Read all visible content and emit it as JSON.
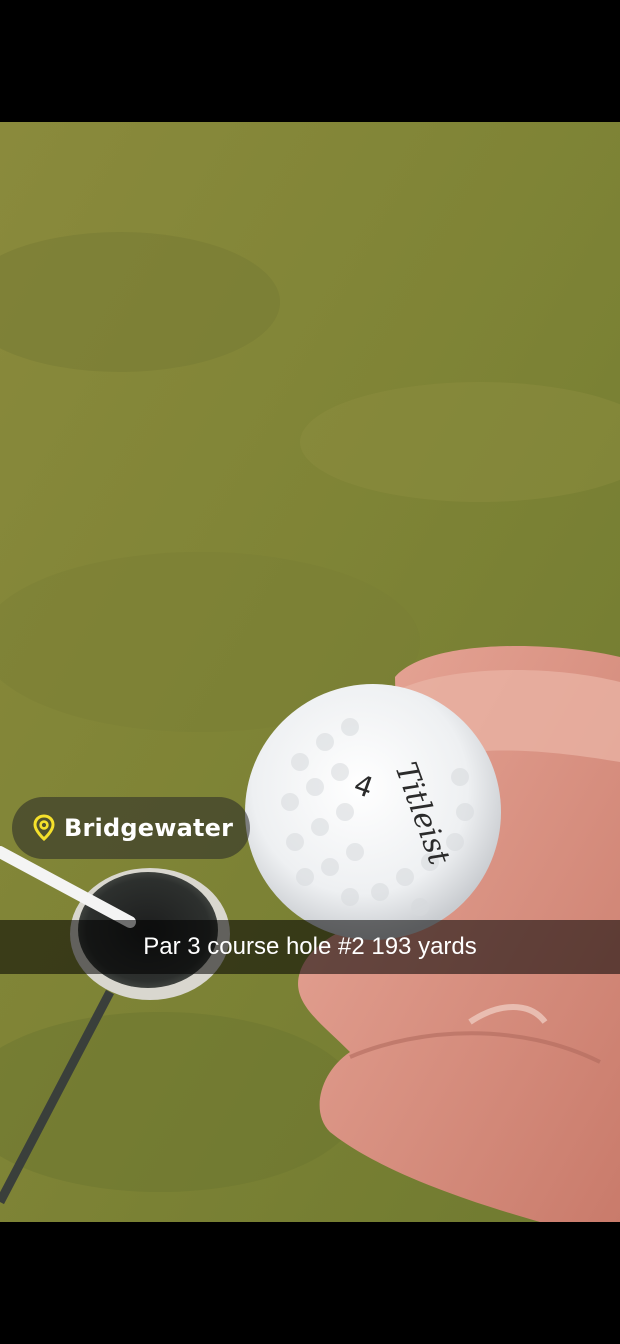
{
  "location": {
    "name": "Bridgewater",
    "icon": "location-pin-icon",
    "icon_color": "#f5e12b"
  },
  "caption": {
    "text": "Par 3 course hole #2 193 yards"
  },
  "photo": {
    "ball_brand": "Titleist",
    "ball_number": "4"
  }
}
